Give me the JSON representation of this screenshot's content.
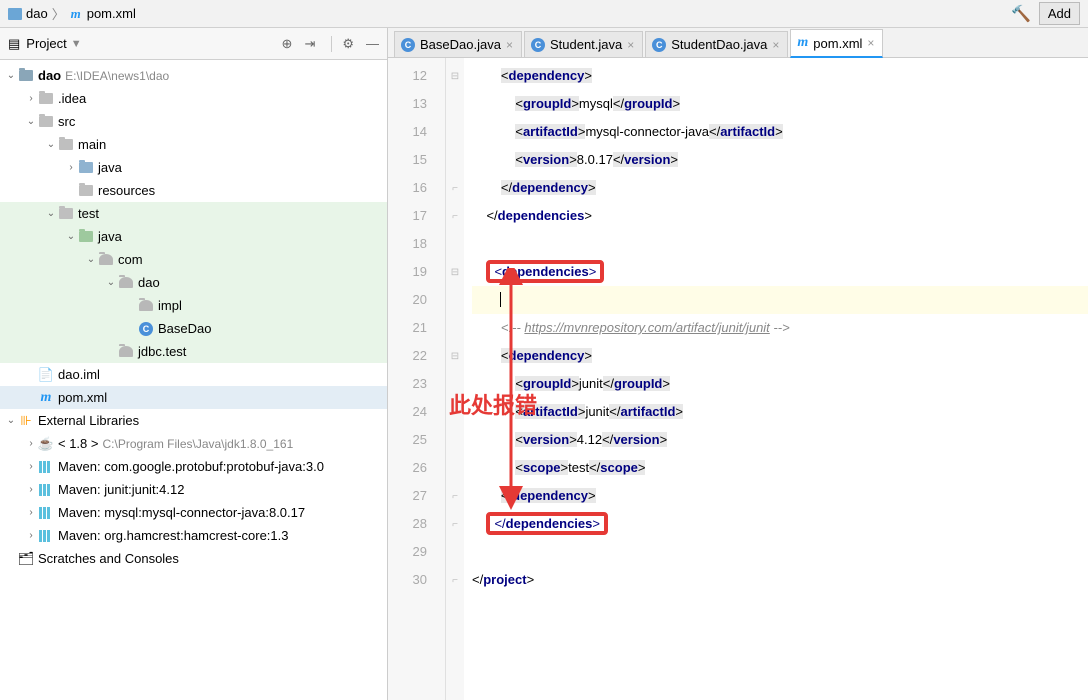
{
  "breadcrumb": {
    "project": "dao",
    "file": "pom.xml"
  },
  "add_button": "Add",
  "project_panel": {
    "title": "Project"
  },
  "tree": {
    "root": "dao",
    "root_path": "E:\\IDEA\\news1\\dao",
    "idea": ".idea",
    "src": "src",
    "main": "main",
    "java1": "java",
    "resources": "resources",
    "test": "test",
    "java2": "java",
    "com": "com",
    "dao_pkg": "dao",
    "impl": "impl",
    "basedao": "BaseDao",
    "jdbc_test": "jdbc.test",
    "dao_iml": "dao.iml",
    "pom": "pom.xml",
    "ext_lib": "External Libraries",
    "jdk": "< 1.8 >",
    "jdk_path": "C:\\Program Files\\Java\\jdk1.8.0_161",
    "m1": "Maven: com.google.protobuf:protobuf-java:3.0",
    "m2": "Maven: junit:junit:4.12",
    "m3": "Maven: mysql:mysql-connector-java:8.0.17",
    "m4": "Maven: org.hamcrest:hamcrest-core:1.3",
    "scratches": "Scratches and Consoles"
  },
  "tabs": {
    "t1": "BaseDao.java",
    "t2": "Student.java",
    "t3": "StudentDao.java",
    "t4": "pom.xml"
  },
  "lines": [
    "12",
    "13",
    "14",
    "15",
    "16",
    "17",
    "18",
    "19",
    "20",
    "21",
    "22",
    "23",
    "24",
    "25",
    "26",
    "27",
    "28",
    "29",
    "30"
  ],
  "code": {
    "l12_tag": "dependency",
    "l13_tag": "groupId",
    "l13_txt": "mysql",
    "l14_tag": "artifactId",
    "l14_txt": "mysql-connector-java",
    "l15_tag": "version",
    "l15_txt": "8.0.17",
    "l16_tag": "dependency",
    "l17_tag": "dependencies",
    "l19_tag": "dependencies",
    "l21_comment": "https://mvnrepository.com/artifact/junit/junit",
    "l22_tag": "dependency",
    "l23_tag": "groupId",
    "l23_txt": "junit",
    "l24_tag": "artifactId",
    "l24_txt": "junit",
    "l25_tag": "version",
    "l25_txt": "4.12",
    "l26_tag": "scope",
    "l26_txt": "test",
    "l27_tag": "dependency",
    "l28_tag": "dependencies",
    "l30_tag": "project"
  },
  "annotation": "此处报错"
}
